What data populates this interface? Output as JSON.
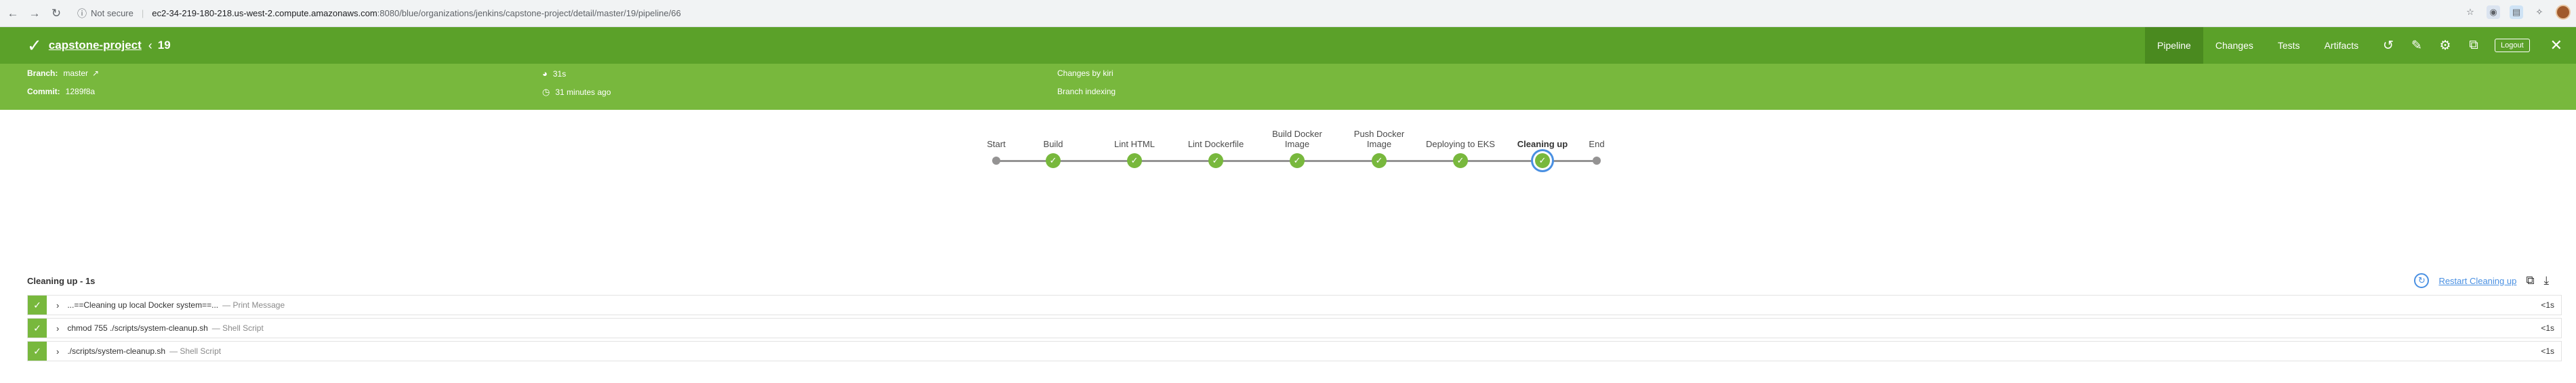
{
  "browser": {
    "security_label": "Not secure",
    "url_host": "ec2-34-219-180-218.us-west-2.compute.amazonaws.com",
    "url_path": ":8080/blue/organizations/jenkins/capstone-project/detail/master/19/pipeline/66"
  },
  "header": {
    "project": "capstone-project",
    "run_number": "19",
    "tabs": [
      "Pipeline",
      "Changes",
      "Tests",
      "Artifacts"
    ],
    "active_tab": "Pipeline",
    "logout_label": "Logout"
  },
  "details": {
    "branch_label": "Branch:",
    "branch_value": "master",
    "commit_label": "Commit:",
    "commit_value": "1289f8a",
    "duration": "31s",
    "time_ago": "31 minutes ago",
    "changes": "Changes by kiri",
    "cause": "Branch indexing"
  },
  "pipeline": {
    "stages": [
      {
        "label": "Start"
      },
      {
        "label": "Build"
      },
      {
        "label": "Lint HTML"
      },
      {
        "label": "Lint Dockerfile"
      },
      {
        "label": "Build Docker Image"
      },
      {
        "label": "Push Docker Image"
      },
      {
        "label": "Deploying to EKS"
      },
      {
        "label": "Cleaning up"
      },
      {
        "label": "End"
      }
    ],
    "selected_stage": "Cleaning up"
  },
  "steps": {
    "title": "Cleaning up - 1s",
    "restart_label": "Restart Cleaning up",
    "items": [
      {
        "name": "...==Cleaning up local Docker system==...",
        "type": "— Print Message",
        "duration": "<1s"
      },
      {
        "name": "chmod 755 ./scripts/system-cleanup.sh",
        "type": "— Shell Script",
        "duration": "<1s"
      },
      {
        "name": "./scripts/system-cleanup.sh",
        "type": "— Shell Script",
        "duration": "<1s"
      }
    ]
  },
  "colors": {
    "header_green": "#5ba129",
    "detail_green": "#78b83d",
    "success_green": "#78b83d",
    "link_blue": "#4a90e2"
  }
}
